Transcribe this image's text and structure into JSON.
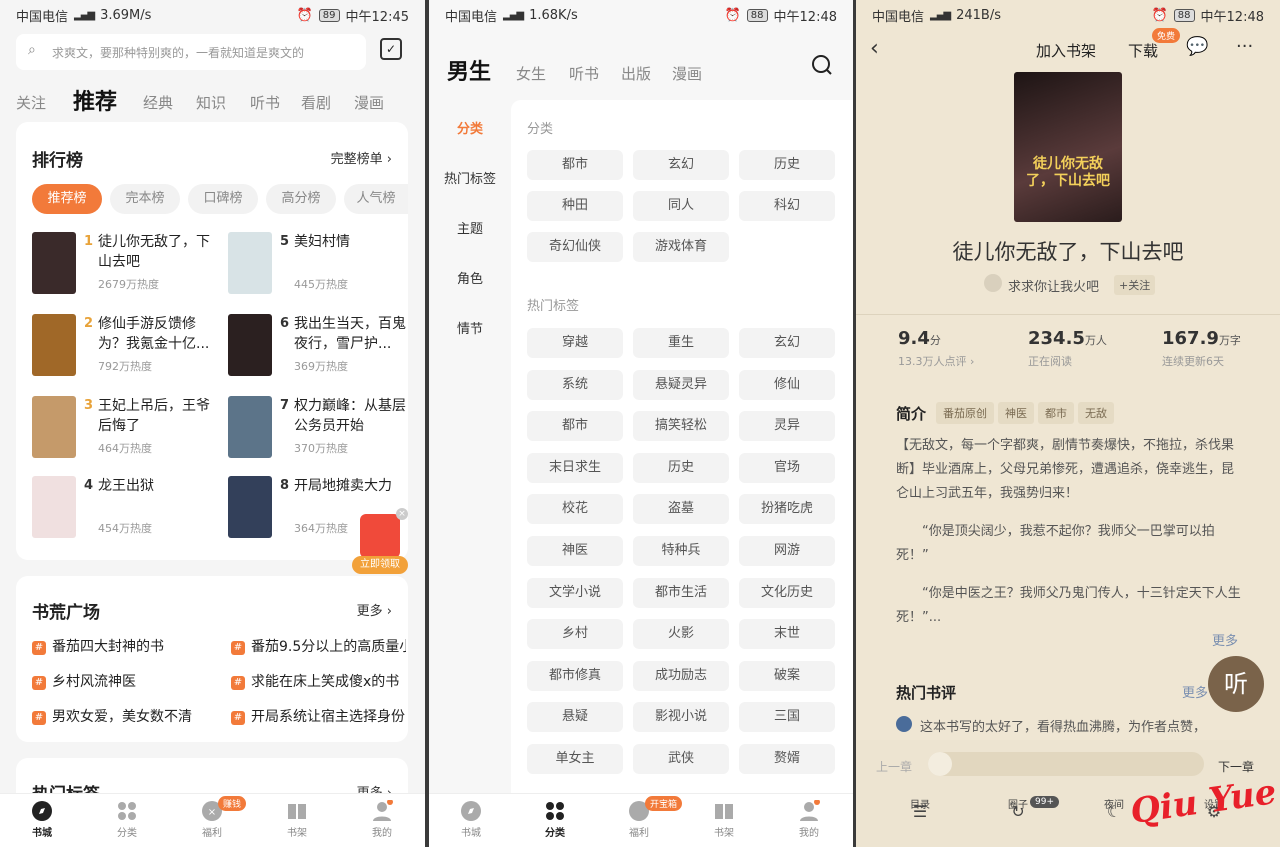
{
  "p1": {
    "status": {
      "carrier": "中国电信",
      "hd": "HD",
      "net": "4G",
      "speed": "3.69M/s",
      "battery": "89",
      "time": "中午12:45"
    },
    "search_placeholder": "求爽文，要那种特别爽的，一看就知道是爽文的",
    "tabs": [
      "关注",
      "推荐",
      "经典",
      "知识",
      "听书",
      "看剧",
      "漫画"
    ],
    "rank": {
      "title": "排行榜",
      "more": "完整榜单 ›",
      "pills": [
        "推荐榜",
        "完本榜",
        "口碑榜",
        "高分榜",
        "人气榜"
      ],
      "items": [
        {
          "n": "1",
          "name": "徒儿你无敌了，下山去吧",
          "heat": "2679万热度",
          "color": "#3a2a2a"
        },
        {
          "n": "5",
          "name": "美妇村情",
          "heat": "445万热度",
          "color": "#d8e3e6"
        },
        {
          "n": "2",
          "name": "修仙手游反馈修为？我氪金十亿...",
          "heat": "792万热度",
          "color": "#a06828"
        },
        {
          "n": "6",
          "name": "我出生当天，百鬼夜行，雪尸护...",
          "heat": "369万热度",
          "color": "#2b2020"
        },
        {
          "n": "3",
          "name": "王妃上吊后，王爷后悔了",
          "heat": "464万热度",
          "color": "#c59a6a"
        },
        {
          "n": "7",
          "name": "权力巅峰：从基层公务员开始",
          "heat": "370万热度",
          "color": "#5c7489"
        },
        {
          "n": "4",
          "name": "龙王出狱",
          "heat": "454万热度",
          "color": "#f0e0e0"
        },
        {
          "n": "8",
          "name": "开局地摊卖大力",
          "heat": "364万热度",
          "color": "#33405a"
        }
      ],
      "redpacket": "立即领取"
    },
    "shuhuang": {
      "title": "书荒广场",
      "more": "更多 ›",
      "items": [
        "番茄四大封神的书",
        "番茄9.5分以上的高质量小",
        "乡村风流神医",
        "求能在床上笑成傻x的书",
        "男欢女爱，美女数不清",
        "开局系统让宿主选择身份"
      ]
    },
    "hot": {
      "title": "热门标签",
      "more": "更多 ›"
    },
    "nav": [
      "书城",
      "分类",
      "福利",
      "书架",
      "我的"
    ],
    "nav_badge": "赚钱"
  },
  "p2": {
    "status": {
      "carrier": "中国电信",
      "hd": "HD",
      "net": "4G",
      "speed": "1.68K/s",
      "battery": "88",
      "time": "中午12:48"
    },
    "tabs": [
      "男生",
      "女生",
      "听书",
      "出版",
      "漫画"
    ],
    "side": [
      "分类",
      "热门标签",
      "主题",
      "角色",
      "情节"
    ],
    "sec1": "分类",
    "cats": [
      "都市",
      "玄幻",
      "历史",
      "种田",
      "同人",
      "科幻",
      "奇幻仙侠",
      "游戏体育"
    ],
    "sec2": "热门标签",
    "tags": [
      "穿越",
      "重生",
      "玄幻",
      "系统",
      "悬疑灵异",
      "修仙",
      "都市",
      "搞笑轻松",
      "灵异",
      "末日求生",
      "历史",
      "官场",
      "校花",
      "盗墓",
      "扮猪吃虎",
      "神医",
      "特种兵",
      "网游",
      "文学小说",
      "都市生活",
      "文化历史",
      "乡村",
      "火影",
      "末世",
      "都市修真",
      "成功励志",
      "破案",
      "悬疑",
      "影视小说",
      "三国",
      "单女主",
      "武侠",
      "赘婿"
    ],
    "nav": [
      "书城",
      "分类",
      "福利",
      "书架",
      "我的"
    ],
    "nav_badge": "开宝箱"
  },
  "p3": {
    "status": {
      "carrier": "中国电信",
      "hd": "HD",
      "net": "4G",
      "speed": "241B/s",
      "battery": "88",
      "time": "中午12:48"
    },
    "top": {
      "add": "加入书架",
      "download": "下载",
      "free": "免费"
    },
    "book": {
      "title": "徒儿你无敌了，下山去吧",
      "author": "求求你让我火吧",
      "follow": "+关注",
      "cover_text": "徒儿你无敌了，下山去吧"
    },
    "stats": [
      {
        "v": "9.4",
        "u": "分",
        "s": "13.3万人点评 ›"
      },
      {
        "v": "234.5",
        "u": "万人",
        "s": "正在阅读"
      },
      {
        "v": "167.9",
        "u": "万字",
        "s": "连续更新6天"
      }
    ],
    "intro_title": "简介",
    "intro_tags": [
      "番茄原创",
      "神医",
      "都市",
      "无敌"
    ],
    "intro": [
      "【无敌文，每一个字都爽，剧情节奏爆快，不拖拉，杀伐果断】毕业酒席上，父母兄弟惨死，遭遇追杀，侥幸逃生，昆仑山上习武五年，我强势归来！",
      "“你是顶尖阔少，我惹不起你？我师父一巴掌可以拍死！”",
      "“你是中医之王？我师父乃鬼门传人，十三针定天下人生死！”..."
    ],
    "more": "更多",
    "reviews_title": "热门书评",
    "reviews_more": "更多",
    "review": "这本书写的太好了，看得热血沸腾，为作者点赞，",
    "listen": "听",
    "prev": "上一章",
    "next": "下一章",
    "bottom": [
      "目录",
      "圈子",
      "夜间",
      "设置"
    ],
    "bottom_badge": "99+",
    "watermark": "Qiu Yue"
  }
}
